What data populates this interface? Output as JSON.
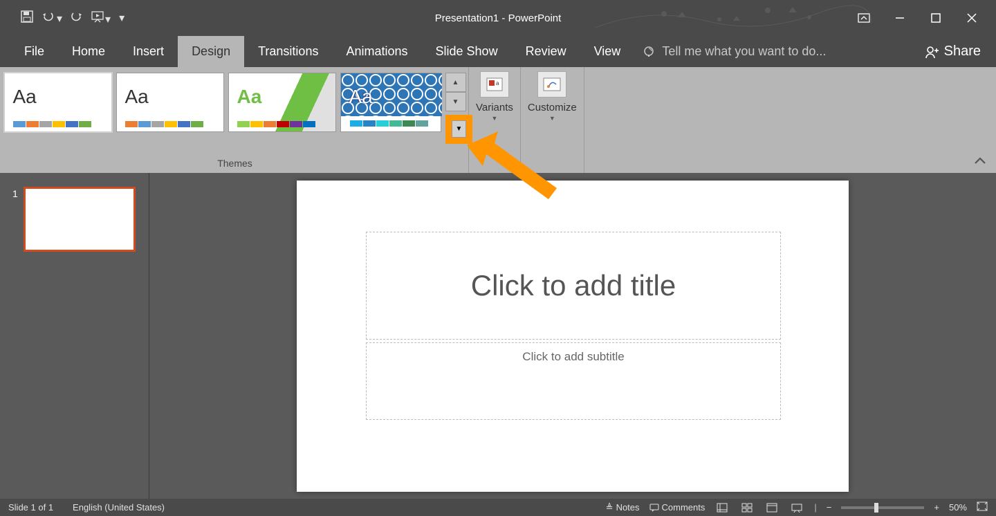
{
  "titlebar": {
    "title": "Presentation1 - PowerPoint"
  },
  "tabs": {
    "file": "File",
    "home": "Home",
    "insert": "Insert",
    "design": "Design",
    "transitions": "Transitions",
    "animations": "Animations",
    "slideshow": "Slide Show",
    "review": "Review",
    "view": "View",
    "tellme": "Tell me what you want to do...",
    "share": "Share"
  },
  "ribbon": {
    "themes_label": "Themes",
    "variants_label": "Variants",
    "customize_label": "Customize",
    "theme_aa": "Aa"
  },
  "slide": {
    "number": "1",
    "title_placeholder": "Click to add title",
    "subtitle_placeholder": "Click to add subtitle"
  },
  "status": {
    "slide_indicator": "Slide 1 of 1",
    "language": "English (United States)",
    "notes": "Notes",
    "comments": "Comments",
    "zoom_level": "50%"
  },
  "theme_palettes": {
    "office": [
      "#5b9bd5",
      "#ed7d31",
      "#a5a5a5",
      "#ffc000",
      "#4472c4",
      "#70ad47"
    ],
    "office2": [
      "#ed7d31",
      "#5b9bd5",
      "#a5a5a5",
      "#ffc000",
      "#4472c4",
      "#70ad47"
    ],
    "facet": [
      "#92d050",
      "#ffc000",
      "#ed7d31",
      "#c00000",
      "#7030a0",
      "#0070c0"
    ],
    "integral": [
      "#1cade4",
      "#2683c6",
      "#27ced7",
      "#42ba97",
      "#3e8853",
      "#62a39f"
    ]
  }
}
